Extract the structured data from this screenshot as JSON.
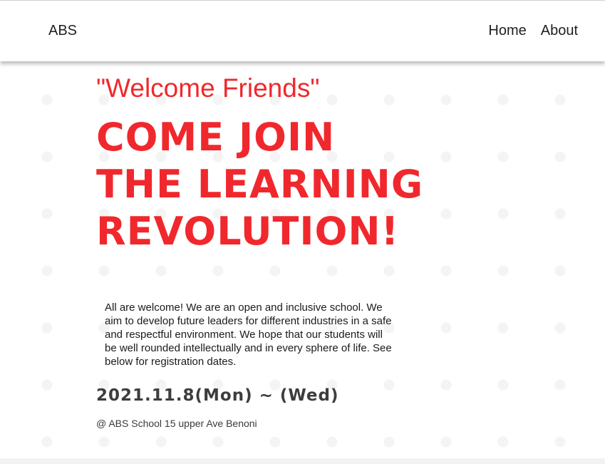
{
  "navbar": {
    "brand": "ABS",
    "links": [
      {
        "label": "Home"
      },
      {
        "label": "About"
      }
    ]
  },
  "hero": {
    "welcome": "\"Welcome Friends\"",
    "headline_lines": [
      "COME JOIN",
      "THE LEARNING",
      "REVOLUTION!"
    ],
    "intro": "All are welcome! We are an open and inclusive school. We aim to develop future leaders for different industries in a safe and respectful environment. We hope that our students will be well rounded intellectually and in every sphere of life. See below for registration dates.",
    "dates": "2021.11.8(Mon) ~ (Wed)",
    "location": "@ ABS School 15 upper Ave Benoni"
  },
  "colors": {
    "accent": "#f0282d",
    "text": "#1a1a1a",
    "dates_text": "#3d3d3d"
  }
}
